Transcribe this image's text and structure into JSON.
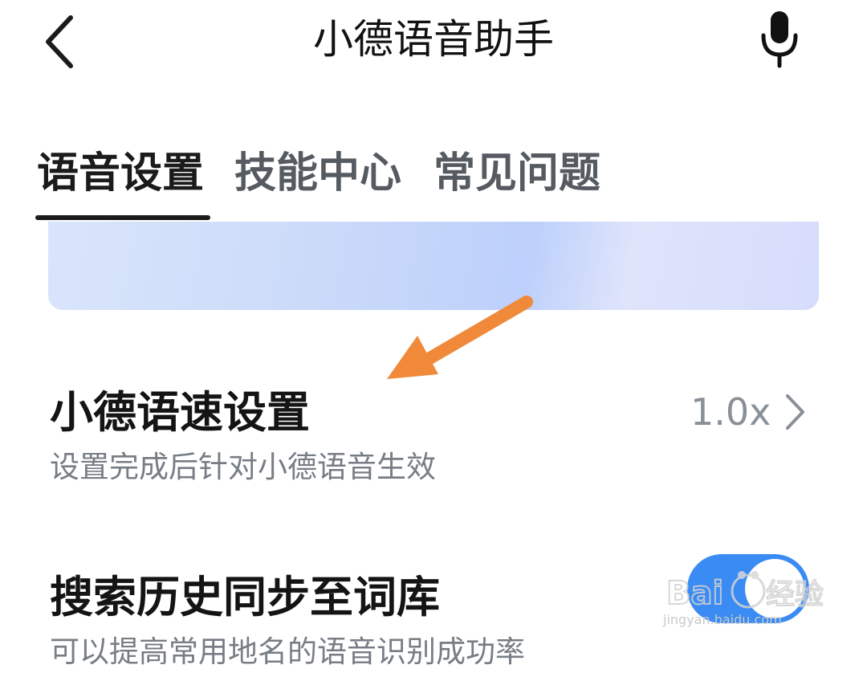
{
  "header": {
    "title": "小德语音助手",
    "back_icon": "chevron-left-icon",
    "mic_icon": "microphone-icon"
  },
  "tabs": [
    {
      "label": "语音设置",
      "active": true
    },
    {
      "label": "技能中心",
      "active": false
    },
    {
      "label": "常见问题",
      "active": false
    }
  ],
  "settings": [
    {
      "title": "小德语速设置",
      "description": "设置完成后针对小德语音生效",
      "value": "1.0x"
    },
    {
      "title": "搜索历史同步至词库",
      "description": "可以提高常用地名的语音识别成功率",
      "toggle_on": true
    }
  ],
  "colors": {
    "accent_blue": "#3a8bf3",
    "annotation_arrow": "#f08a3a",
    "text_primary": "#141414",
    "text_secondary": "#777d84"
  },
  "watermark": {
    "text": "Baidu经验",
    "url_text": "jingyan.baidu.com"
  }
}
